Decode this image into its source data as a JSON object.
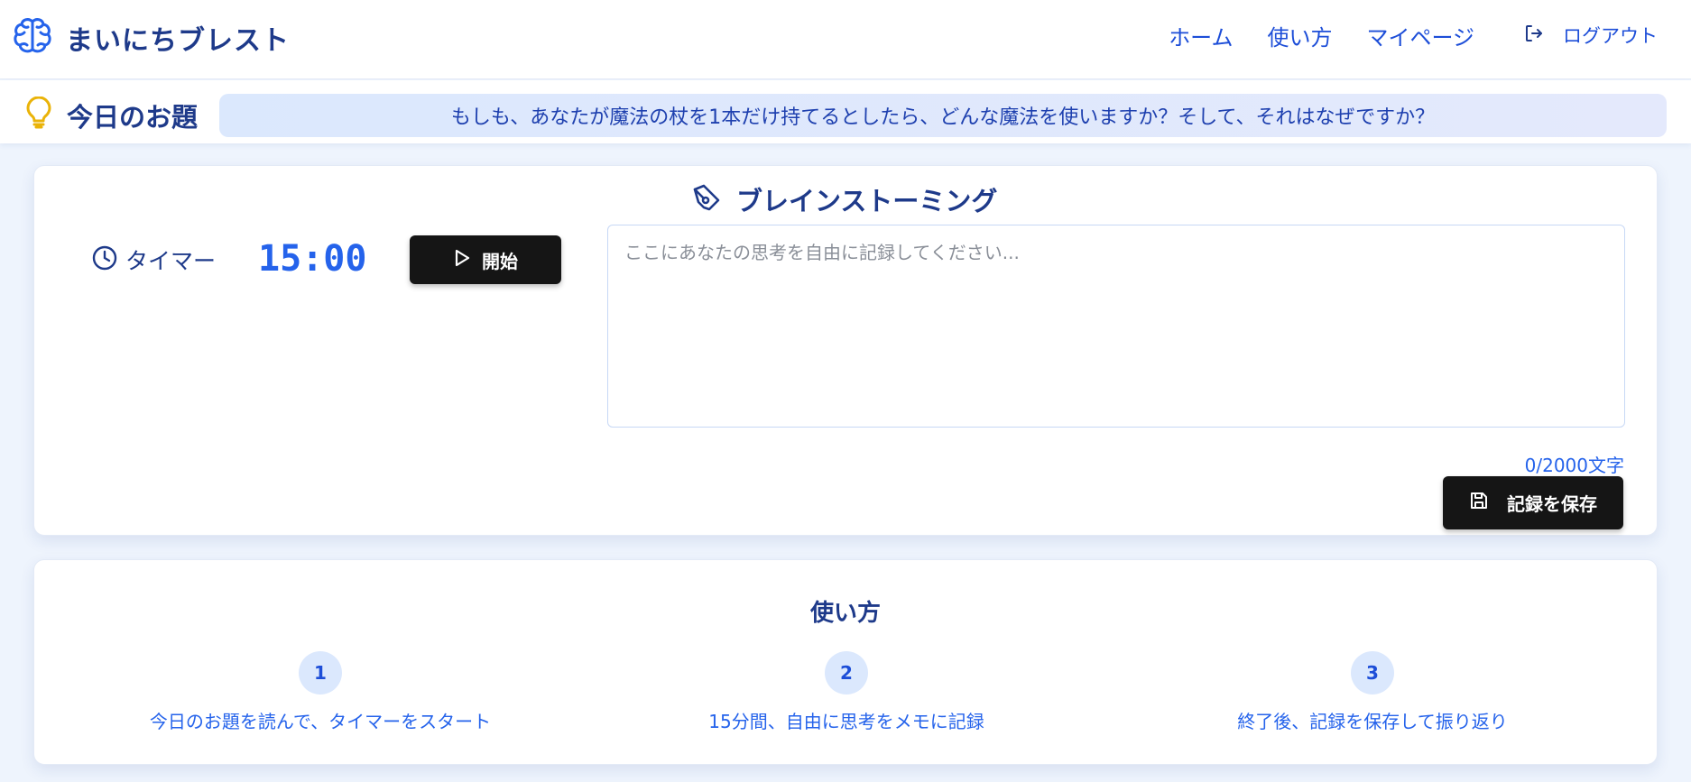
{
  "app": {
    "title": "まいにちブレスト",
    "logo_icon": "brain-icon",
    "accent_color": "#2563eb"
  },
  "nav": {
    "items": [
      {
        "label": "ホーム"
      },
      {
        "label": "使い方"
      },
      {
        "label": "マイページ"
      }
    ],
    "logout_label": "ログアウト"
  },
  "topic": {
    "heading": "今日のお題",
    "text": "もしも、あなたが魔法の杖を1本だけ持てるとしたら、どんな魔法を使いますか？そして、それはなぜですか？"
  },
  "brainstorm": {
    "title": "ブレインストーミング",
    "timer_label": "タイマー",
    "timer_value": "15:00",
    "start_label": "開始",
    "memo_placeholder": "ここにあなたの思考を自由に記録してください...",
    "char_count": "0/2000文字",
    "save_label": "記録を保存"
  },
  "howto": {
    "title": "使い方",
    "steps": [
      {
        "num": "1",
        "text": "今日のお題を読んで、タイマーをスタート"
      },
      {
        "num": "2",
        "text": "15分間、自由に思考をメモに記録"
      },
      {
        "num": "3",
        "text": "終了後、記録を保存して振り返り"
      }
    ]
  }
}
